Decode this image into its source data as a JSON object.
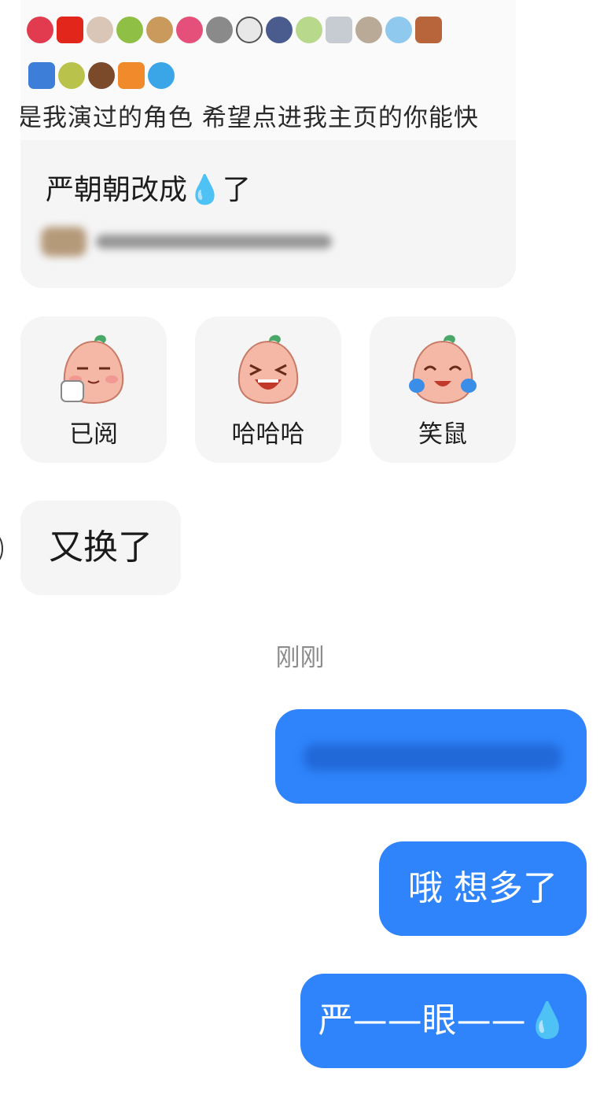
{
  "shared_card": {
    "bio_text": "是我演过的角色 希望点进我主页的你能快",
    "title_text": "严朝朝改成",
    "title_emoji": "💧",
    "title_suffix": "了",
    "row1_emoji": [
      "lips",
      "china-flag",
      "person",
      "dragon",
      "camel",
      "tulip",
      "microphone",
      "circled-11",
      "police-officer",
      "fairy",
      "fog",
      "shell",
      "snowflake",
      "book"
    ],
    "row2_emoji": [
      "keycap-1",
      "pear",
      "person-hair",
      "sunset",
      "droplet"
    ]
  },
  "quick_replies": [
    {
      "label": "已阅",
      "icon": "sipping-tea-peach-sticker-icon"
    },
    {
      "label": "哈哈哈",
      "icon": "laughing-peach-sticker-icon"
    },
    {
      "label": "笑鼠",
      "icon": "laugh-crying-peach-sticker-icon"
    }
  ],
  "messages": {
    "incoming_1": "又换了",
    "timestamp": "刚刚",
    "outgoing_2": "哦 想多了",
    "outgoing_3_text": "严——眼——",
    "outgoing_3_emoji": "💧"
  },
  "colors": {
    "accent_blue": "#2f84fb",
    "bubble_gray": "#f5f5f6",
    "timestamp_gray": "#8c8c8c"
  }
}
